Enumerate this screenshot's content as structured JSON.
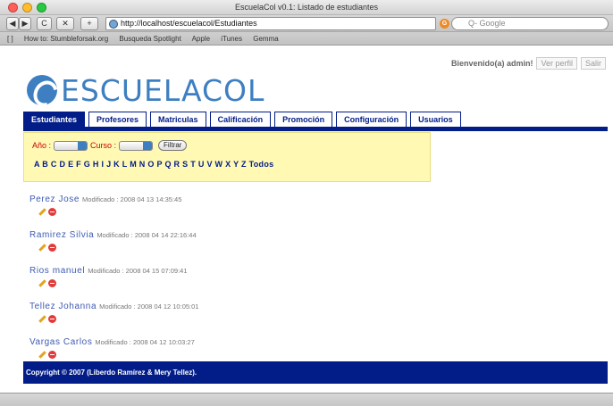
{
  "window": {
    "title": "EscuelaCol v0.1: Listado de estudiantes"
  },
  "toolbar": {
    "back": "◀",
    "forward": "▶",
    "reload": "C",
    "stop": "✕",
    "add": "+",
    "url": "http://localhost/escuelacol/Estudiantes",
    "search_placeholder": "Q- Google"
  },
  "bookmarks": [
    "[ ]",
    "How to: Stumbleforsak.org",
    "Busqueda Spotlight",
    "Apple",
    "iTunes",
    "Gemma"
  ],
  "userbar": {
    "greeting": "Bienvenido(a) admin!",
    "profile": "Ver perfil",
    "logout": "Salir"
  },
  "logo": {
    "text": "ESCUELACOL"
  },
  "tabs": [
    "Estudiantes",
    "Profesores",
    "Matriculas",
    "Calificación",
    "Promoción",
    "Configuración",
    "Usuarios"
  ],
  "filter": {
    "year_label": "Año :",
    "course_label": "Curso :",
    "button": "Filtrar",
    "alphabet": "A B C D E F G H I J K L M N O P Q R S T U V W X Y Z Todos"
  },
  "students": [
    {
      "name": "Perez Jose",
      "modified": "Modificado : 2008 04 13 14:35:45"
    },
    {
      "name": "Ramirez Silvia",
      "modified": "Modificado : 2008 04 14 22:16:44"
    },
    {
      "name": "Rios manuel",
      "modified": "Modificado : 2008 04 15 07:09:41"
    },
    {
      "name": "Tellez Johanna",
      "modified": "Modificado : 2008 04 12 10:05:01"
    },
    {
      "name": "Vargas Carlos",
      "modified": "Modificado : 2008 04 12 10:03:27"
    }
  ],
  "footer": {
    "text": "Copyright © 2007 (Liberdo Ramírez & Mery Tellez)."
  },
  "colors": {
    "brand": "#3d7fc1",
    "navy": "#021c88",
    "filter_bg": "#fff9b3",
    "filter_label": "#c80000"
  }
}
